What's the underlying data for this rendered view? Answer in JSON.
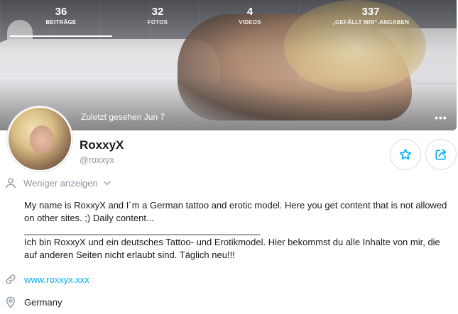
{
  "stats": [
    {
      "value": "36",
      "label": "BEITRÄGE"
    },
    {
      "value": "32",
      "label": "FOTOS"
    },
    {
      "value": "4",
      "label": "VIDEOS"
    },
    {
      "value": "337",
      "label": "„GEFÄLLT MIR\"-ANGABEN"
    }
  ],
  "cover": {
    "last_seen": "Zuletzt gesehen Jun 7",
    "more_icon": "ellipsis-icon"
  },
  "profile": {
    "name": "RoxxyX",
    "handle": "@roxxyx"
  },
  "actions": {
    "favorite_icon": "star-icon",
    "share_icon": "share-icon"
  },
  "info": {
    "toggle_label": "Weniger anzeigen",
    "bio_en": "My name is RoxxyX and I´m a German tattoo and erotic model. Here you get content that is not allowed on other sites. ;) Daily content...",
    "bio_divider": "______________________________________________",
    "bio_de": "Ich bin RoxxyX und ein deutsches Tattoo- und Erotikmodel. Hier bekommst du alle Inhalte von mir, die auf anderen Seiten nicht erlaubt sind. Täglich neu!!!",
    "website": "www.roxxyx.xxx",
    "location": "Germany"
  },
  "colors": {
    "accent": "#00aff0",
    "muted": "#8a96a3",
    "border": "#d7dbe0"
  }
}
